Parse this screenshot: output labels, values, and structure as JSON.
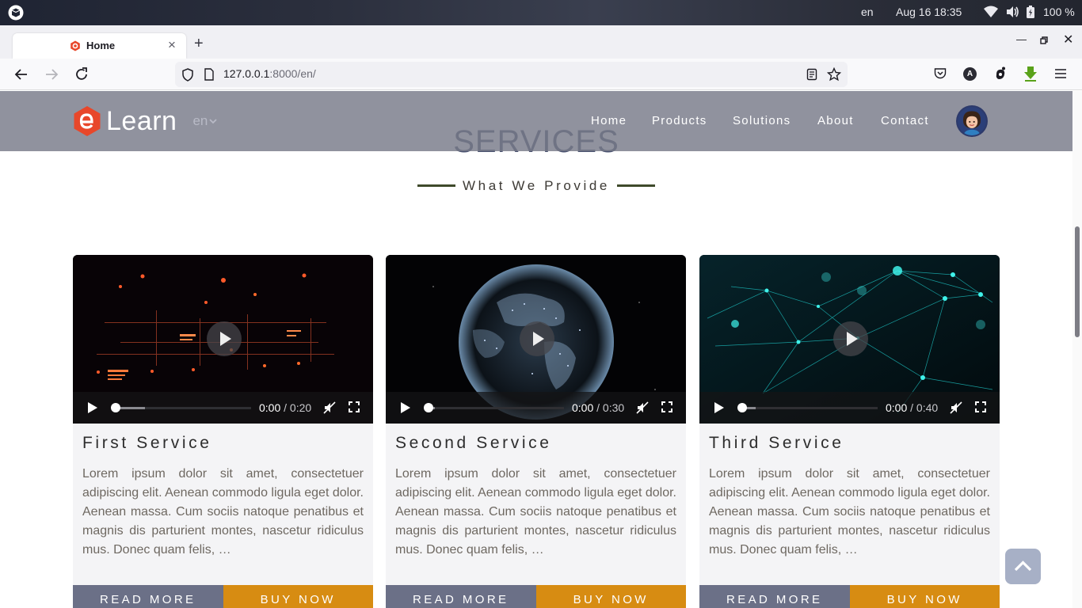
{
  "os": {
    "language": "en",
    "datetime": "Aug 16  18:35",
    "battery": "100 %"
  },
  "browser": {
    "tab_title": "Home",
    "url_host": "127.0.0.1",
    "url_path": ":8000/en/",
    "account_initial": "A"
  },
  "site": {
    "brand": "Learn",
    "language_selector": "en",
    "menu": [
      "Home",
      "Products",
      "Solutions",
      "About",
      "Contact"
    ]
  },
  "section": {
    "title": "SERVICES",
    "subtitle": "What We Provide"
  },
  "services": [
    {
      "title": "First Service",
      "description": "Lorem ipsum dolor sit amet, consectetuer adipiscing elit. Aenean commodo ligula eget dolor. Aenean massa. Cum sociis natoque penatibus et magnis dis parturient montes, nascetur ridiculus mus. Donec quam felis, …",
      "current_time": "0:00",
      "duration": "/ 0:20",
      "read_more": "READ MORE",
      "buy_now": "BUY NOW"
    },
    {
      "title": "Second Service",
      "description": "Lorem ipsum dolor sit amet, consectetuer adipiscing elit. Aenean commodo ligula eget dolor. Aenean massa. Cum sociis natoque penatibus et magnis dis parturient montes, nascetur ridiculus mus. Donec quam felis, …",
      "current_time": "0:00",
      "duration": "/ 0:30",
      "read_more": "READ MORE",
      "buy_now": "BUY NOW"
    },
    {
      "title": "Third Service",
      "description": "Lorem ipsum dolor sit amet, consectetuer adipiscing elit. Aenean commodo ligula eget dolor. Aenean massa. Cum sociis natoque penatibus et magnis dis parturient montes, nascetur ridiculus mus. Donec quam felis, …",
      "current_time": "0:00",
      "duration": "/ 0:40",
      "read_more": "READ MORE",
      "buy_now": "BUY NOW"
    }
  ],
  "colors": {
    "brand_orange": "#e8472a",
    "read_more_bg": "#6b7087",
    "buy_now_bg": "#d78c12",
    "header_bg": "#787a89"
  }
}
